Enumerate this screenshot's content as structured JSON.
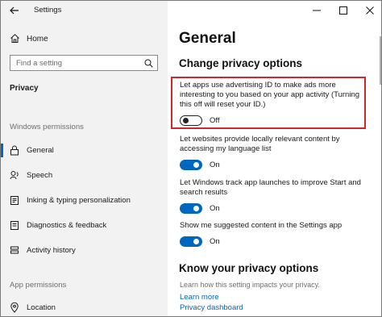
{
  "window": {
    "app_title": "Settings",
    "controls": [
      "minimize",
      "maximize",
      "close"
    ]
  },
  "sidebar": {
    "home_label": "Home",
    "search_placeholder": "Find a setting",
    "section_title": "Privacy",
    "groups": [
      {
        "label": "Windows permissions",
        "items": [
          {
            "label": "General",
            "icon": "lock-icon",
            "selected": true
          },
          {
            "label": "Speech",
            "icon": "speech-icon",
            "selected": false
          },
          {
            "label": "Inking & typing personalization",
            "icon": "inking-icon",
            "selected": false
          },
          {
            "label": "Diagnostics & feedback",
            "icon": "diagnostics-icon",
            "selected": false
          },
          {
            "label": "Activity history",
            "icon": "activity-icon",
            "selected": false
          }
        ]
      },
      {
        "label": "App permissions",
        "items": [
          {
            "label": "Location",
            "icon": "location-icon",
            "selected": false
          }
        ]
      }
    ]
  },
  "main": {
    "page_title": "General",
    "change_title": "Change privacy options",
    "settings": [
      {
        "description": "Let apps use advertising ID to make ads more interesting to you based on your app activity (Turning this off will reset your ID.)",
        "state": "Off",
        "on": false
      },
      {
        "description": "Let websites provide locally relevant content by accessing my language list",
        "state": "On",
        "on": true
      },
      {
        "description": "Let Windows track app launches to improve Start and search results",
        "state": "On",
        "on": true
      },
      {
        "description": "Show me suggested content in the Settings app",
        "state": "On",
        "on": true
      }
    ],
    "know_title": "Know your privacy options",
    "know_desc": "Learn how this setting impacts your privacy.",
    "links": [
      "Learn more",
      "Privacy dashboard"
    ]
  },
  "colors": {
    "accent": "#0067c0",
    "highlight": "#d0262c",
    "sidebar_bg": "#f2f2f2"
  }
}
